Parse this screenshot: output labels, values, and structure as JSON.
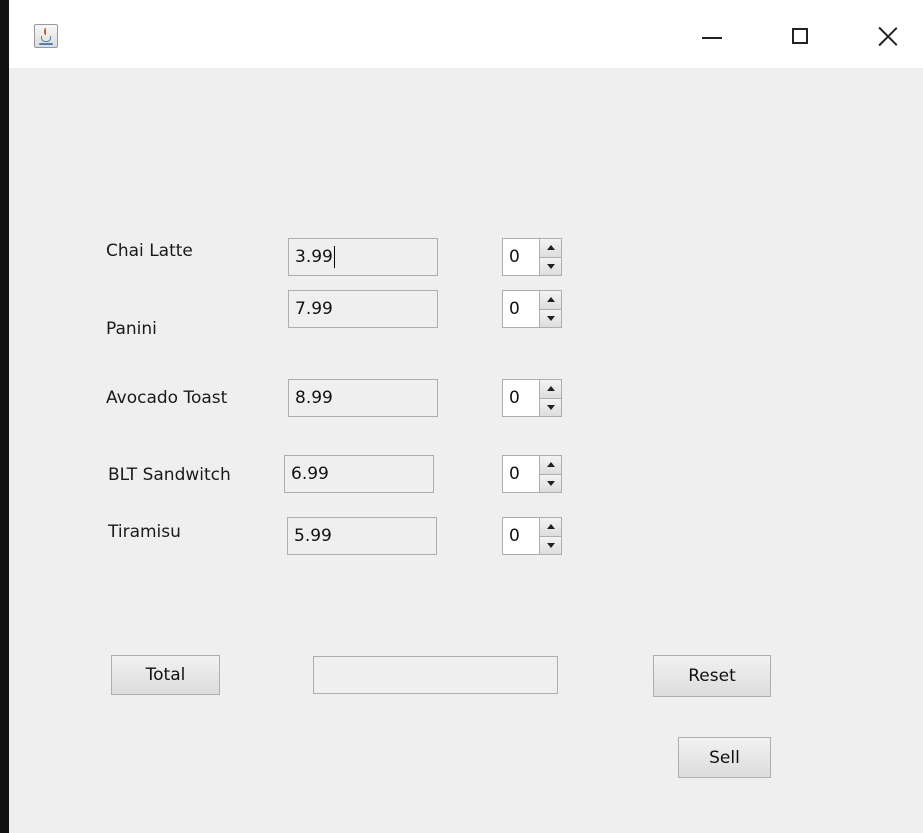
{
  "window": {
    "controls": {
      "minimize_icon": "minimize-icon",
      "maximize_icon": "maximize-icon",
      "close_icon": "close-icon"
    }
  },
  "items": [
    {
      "name": "Chai Latte",
      "price": "3.99",
      "quantity": "0"
    },
    {
      "name": "Panini",
      "price": "7.99",
      "quantity": "0"
    },
    {
      "name": "Avocado Toast",
      "price": "8.99",
      "quantity": "0"
    },
    {
      "name": "BLT Sandwitch",
      "price": "6.99",
      "quantity": "0"
    },
    {
      "name": "Tiramisu",
      "price": "5.99",
      "quantity": "0"
    }
  ],
  "actions": {
    "total_label": "Total",
    "total_value": "",
    "reset_label": "Reset",
    "sell_label": "Sell"
  },
  "colors": {
    "content_bg": "#efefef",
    "field_border": "#aeaeae"
  }
}
